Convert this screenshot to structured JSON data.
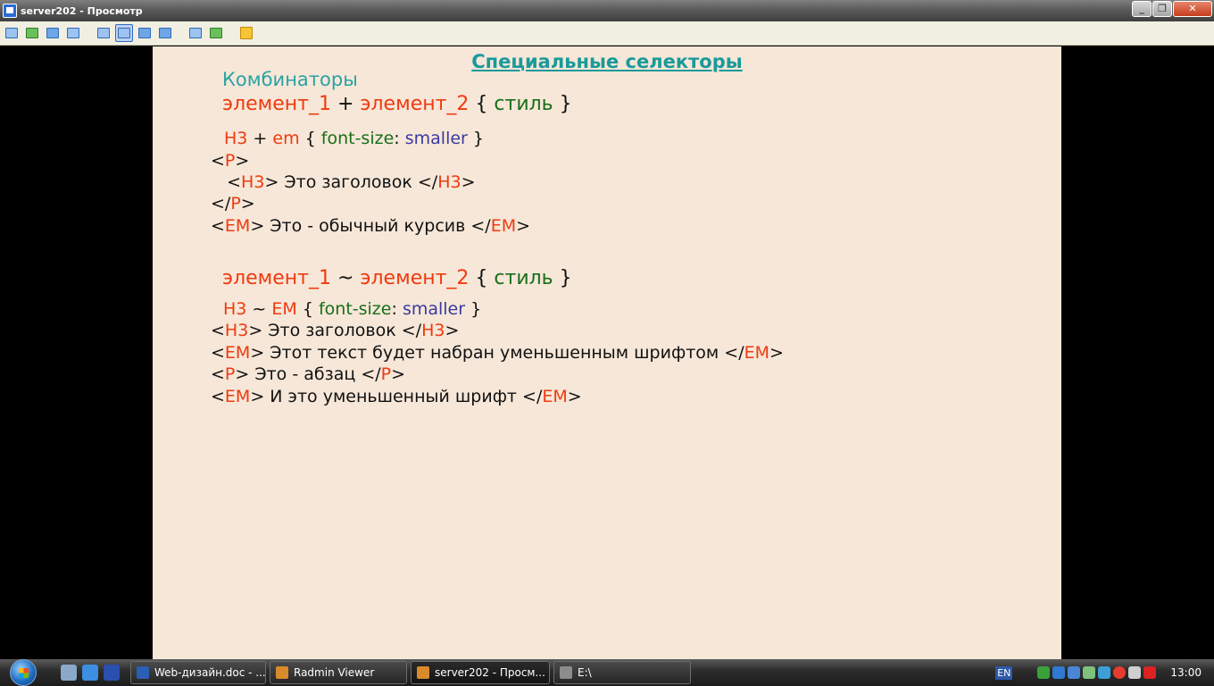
{
  "window": {
    "title": "server202 - Просмотр",
    "buttons": [
      "minimize",
      "restore",
      "close"
    ]
  },
  "toolbar": {
    "icons": [
      "connect-icon",
      "transfer-icon",
      "voice-chat-icon",
      "text-chat-icon",
      "window-mode-icon",
      "fullscreen-stretch-icon",
      "fullscreen-icon",
      "snapshot-icon",
      "settings-icon",
      "disconnect-icon"
    ],
    "active": "fullscreen-stretch-icon"
  },
  "slide": {
    "title": "Специальные селекторы",
    "subtitle": "Комбинаторы",
    "rule1": {
      "el1": "элемент_1",
      "op": " + ",
      "el2": "элемент_2",
      "open": " { ",
      "style": "стиль",
      "close": " }"
    },
    "ex1": {
      "sel": {
        "a": "H3",
        "op": " + ",
        "b": "em",
        "open": " { ",
        "prop": "font-size",
        "colon": ": ",
        "val": "smaller",
        "close": " }"
      },
      "lines": [
        {
          "p": "<",
          "t": "P",
          "s": ">"
        },
        {
          "p": "   <",
          "t": "H3",
          "m": "> Это заголовок </",
          "t2": "H3",
          "s": ">"
        },
        {
          "p": "</",
          "t": "P",
          "s": ">"
        },
        {
          "p": "<",
          "t": "EM",
          "m": "> Это - обычный курсив </",
          "t2": "EM",
          "s": ">"
        }
      ]
    },
    "rule2": {
      "el1": "элемент_1",
      "op": " ~ ",
      "el2": "элемент_2",
      "open": " { ",
      "style": "стиль",
      "close": " }"
    },
    "ex2": {
      "sel": {
        "a": "H3",
        "op": " ~ ",
        "b": "EM",
        "open": " { ",
        "prop": "font-size",
        "colon": ": ",
        "val": "smaller",
        "close": " }"
      },
      "lines": [
        {
          "p": "<",
          "t": "H3",
          "m": "> Это заголовок </",
          "t2": "H3",
          "s": ">"
        },
        {
          "p": "<",
          "t": "EM",
          "m": "> Этот текст будет набран уменьшенным шрифтом </",
          "t2": "EM",
          "s": ">"
        },
        {
          "p": "<",
          "t": "P",
          "m": "> Это - абзац </",
          "t2": "P",
          "s": ">"
        },
        {
          "p": "<",
          "t": "EM",
          "m": "> И это уменьшенный шрифт </",
          "t2": "EM",
          "s": ">"
        }
      ]
    }
  },
  "taskbar": {
    "tasks": [
      {
        "label": "Web-дизайн.doc - ...",
        "icon": "word-doc-icon"
      },
      {
        "label": "Radmin Viewer",
        "icon": "radmin-icon"
      },
      {
        "label": "server202 - Просм...",
        "icon": "viewer-window-icon"
      },
      {
        "label": "E:\\",
        "icon": "drive-icon"
      }
    ],
    "lang": "EN",
    "clock": "13:00"
  }
}
